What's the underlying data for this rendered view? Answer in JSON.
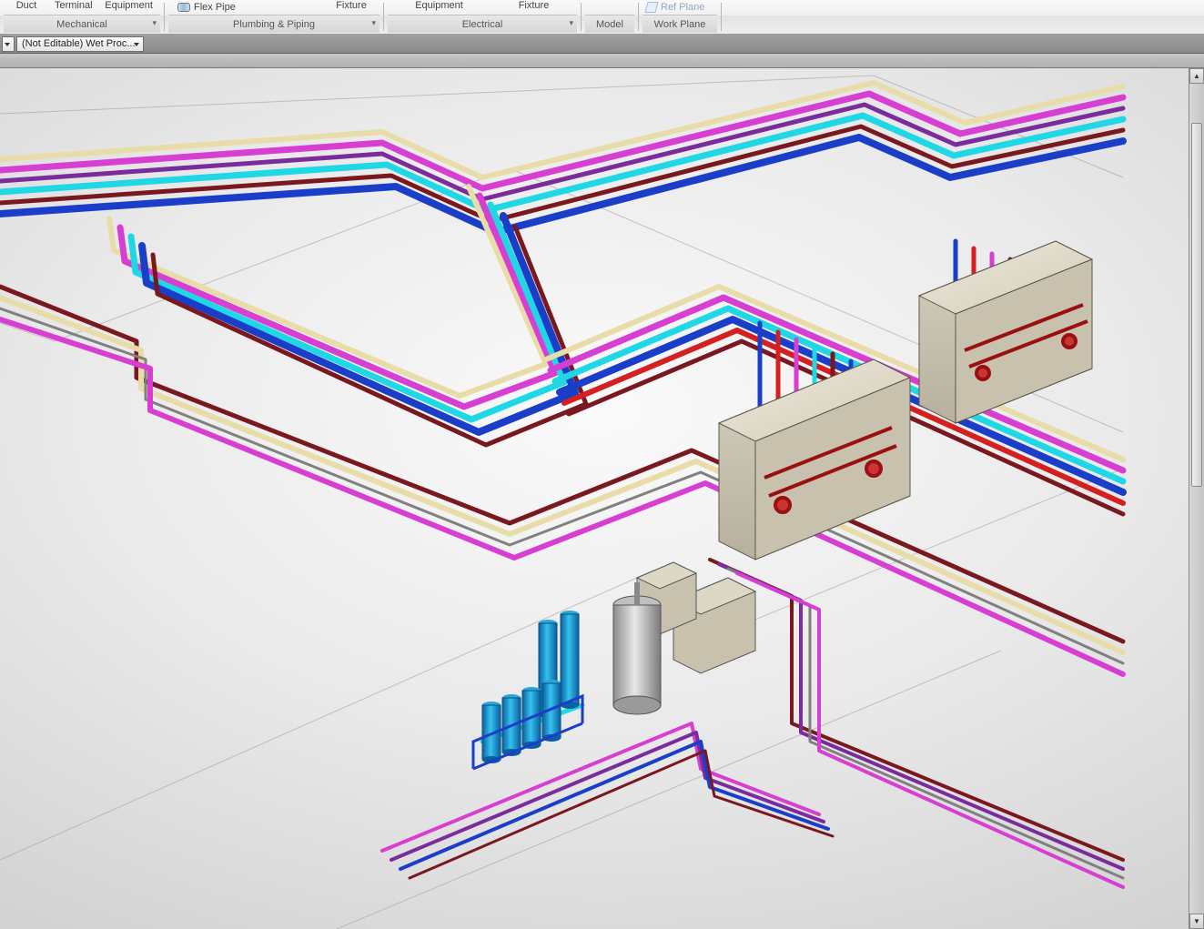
{
  "ribbon": {
    "mechanical": {
      "title": "Mechanical",
      "items": {
        "duct": "Duct",
        "terminal": "Terminal",
        "equipment": "Equipment"
      }
    },
    "plumbing": {
      "title": "Plumbing & Piping",
      "flex_pipe": "Flex Pipe",
      "fixture": "Fixture"
    },
    "electrical": {
      "title": "Electrical",
      "equipment": "Equipment",
      "fixture": "Fixture"
    },
    "model": {
      "title": "Model"
    },
    "work_plane": {
      "title": "Work Plane",
      "ref_plane": "Ref Plane"
    }
  },
  "options_bar": {
    "view_selector": "(Not Editable) Wet Proc..."
  },
  "pipe_colors": {
    "cream": "#e8dca8",
    "magenta": "#d63fd1",
    "purple": "#7a2c9c",
    "cyan": "#20d7e6",
    "blue": "#1b3ec8",
    "darkred": "#7a1820",
    "red": "#d42020",
    "grey": "#808080"
  }
}
